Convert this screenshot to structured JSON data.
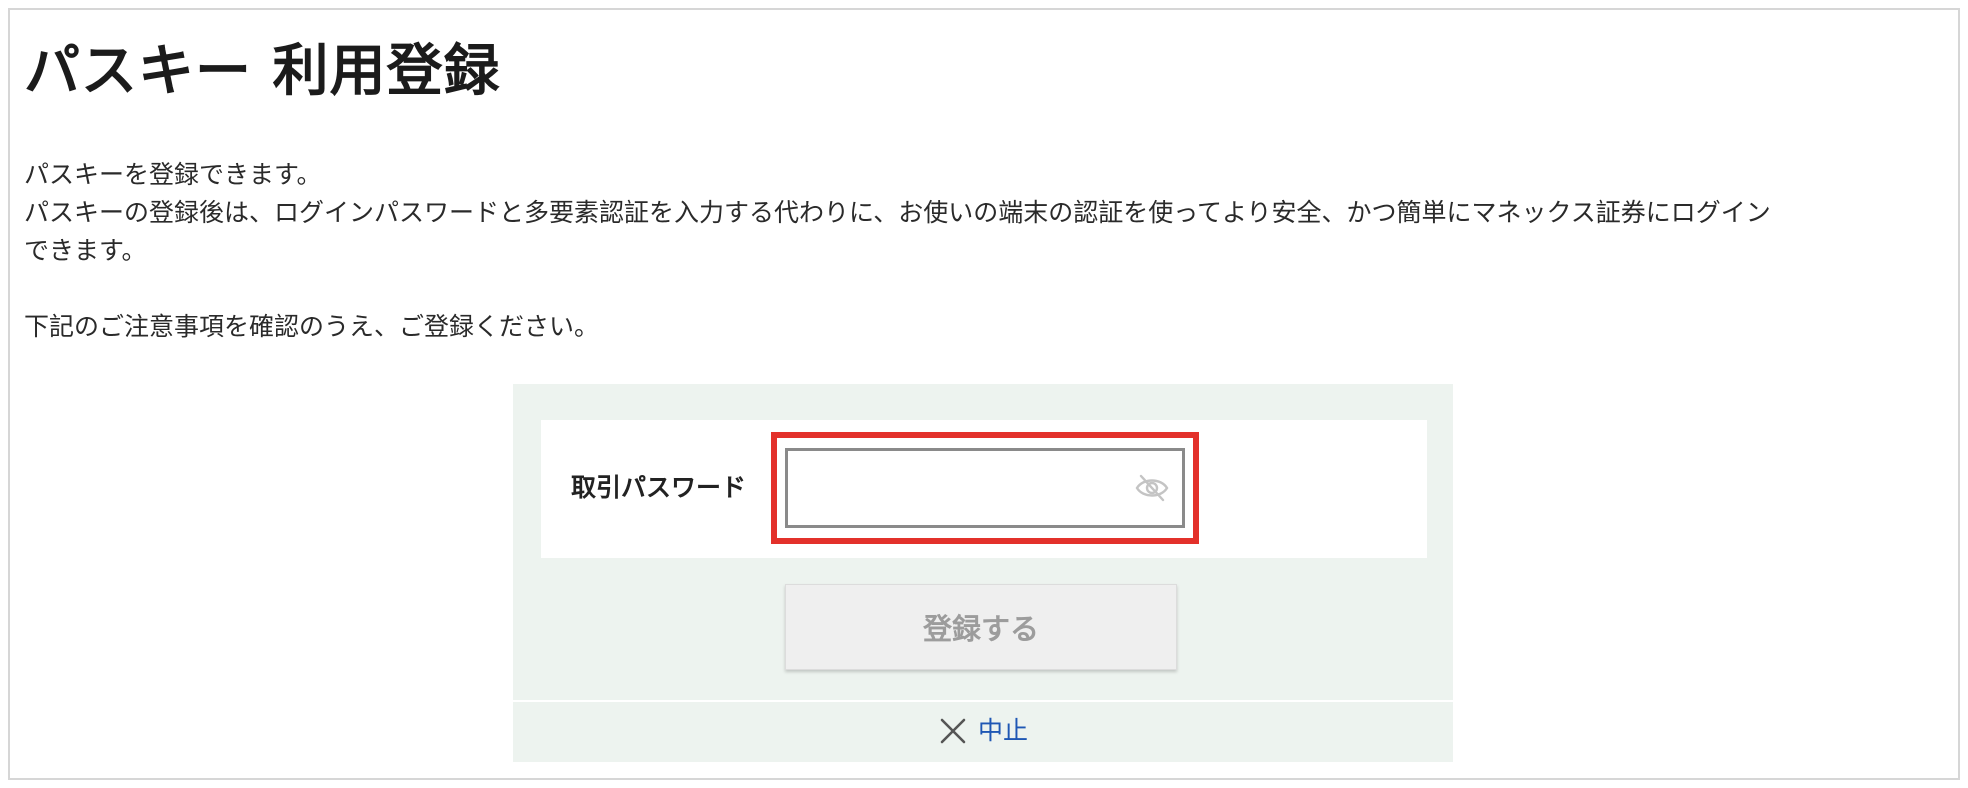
{
  "page": {
    "title": "パスキー 利用登録",
    "description": [
      "パスキーを登録できます。",
      "パスキーの登録後は、ログインパスワードと多要素認証を入力する代わりに、お使いの端末の認証を使ってより安全、かつ簡単にマネックス証券にログイン",
      "できます。"
    ],
    "note": "下記のご注意事項を確認のうえ、ご登録ください。"
  },
  "form": {
    "password_label": "取引パスワード",
    "password_value": "",
    "password_placeholder": "",
    "eye_icon": "eye-off-icon",
    "register_label": "登録する",
    "cancel_label": "中止",
    "cancel_icon": "close-icon"
  },
  "colors": {
    "highlight": "#e3312b",
    "panel_bg": "#edf3ef",
    "link": "#1f57b4",
    "button_disabled_text": "#9c9c9c"
  }
}
